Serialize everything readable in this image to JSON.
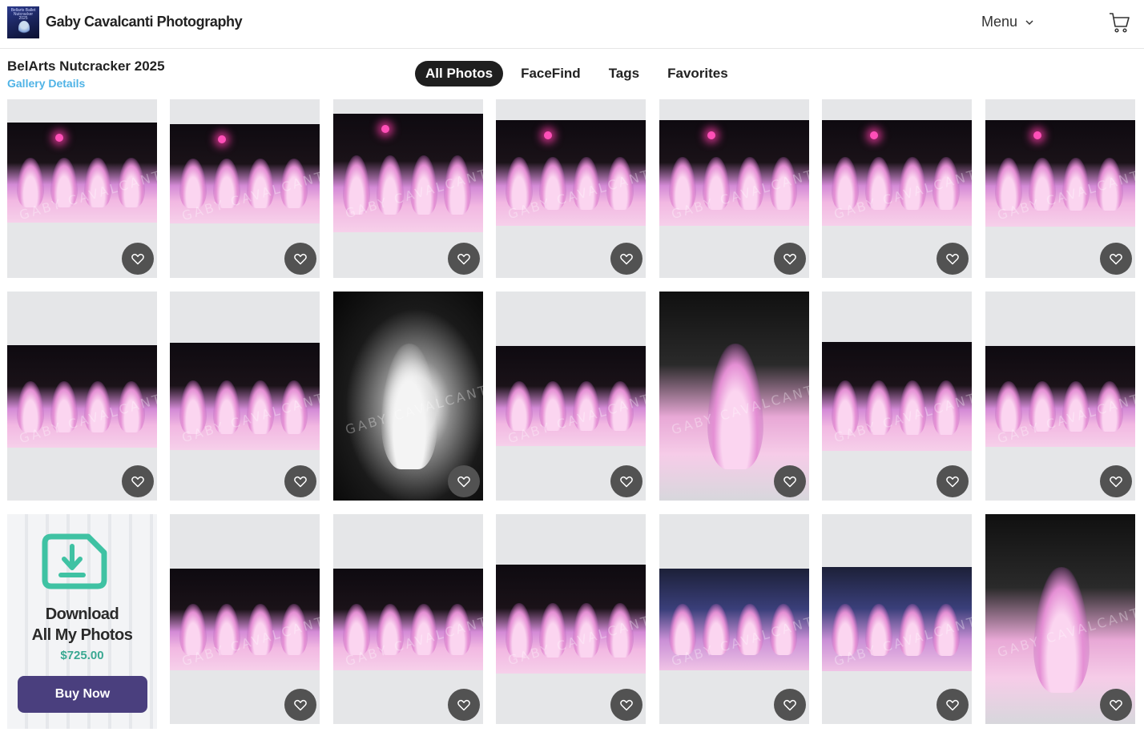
{
  "header": {
    "site_title": "Gaby Cavalcanti Photography",
    "logo_text": "Bellarts Ballet Nutcracker 2025",
    "menu_label": "Menu"
  },
  "gallery": {
    "title": "BelArts Nutcracker 2025",
    "details_link": "Gallery Details"
  },
  "tabs": [
    {
      "label": "All Photos",
      "active": true
    },
    {
      "label": "FaceFind",
      "active": false
    },
    {
      "label": "Tags",
      "active": false
    },
    {
      "label": "Favorites",
      "active": false
    }
  ],
  "watermark_text": "GABY CAVALCANTI | PHOTOGRAPHY |",
  "promo": {
    "title_line1": "Download",
    "title_line2": "All My Photos",
    "price": "$725.00",
    "button_label": "Buy Now",
    "accent_color": "#3fc2a3",
    "button_color": "#4a3f7e"
  },
  "colors": {
    "tab_active_bg": "#1f1f1f",
    "link": "#4fb3e6",
    "tile_bg": "#e5e6e8",
    "favorite_button": "#525252"
  },
  "icons": {
    "menu": "chevron-down-icon",
    "cart": "cart-icon",
    "favorite": "heart-icon",
    "download": "download-icon"
  }
}
